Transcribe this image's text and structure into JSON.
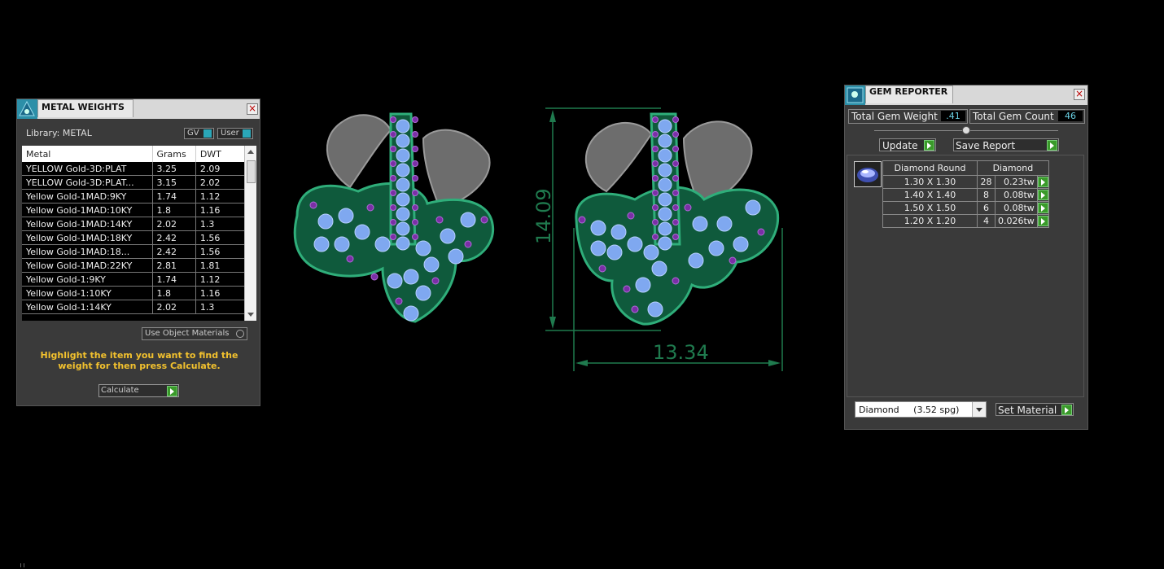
{
  "metal_panel": {
    "title": "METAL WEIGHTS",
    "library_label": "Library: METAL",
    "gv_label": "GV",
    "user_label": "User",
    "columns": [
      "Metal",
      "Grams",
      "DWT"
    ],
    "rows": [
      [
        "YELLOW Gold-3D:PLAT",
        "3.25",
        "2.09"
      ],
      [
        "YELLOW Gold-3D:PLAT...",
        "3.15",
        "2.02"
      ],
      [
        "Yellow Gold-1MAD:9KY",
        "1.74",
        "1.12"
      ],
      [
        "Yellow Gold-1MAD:10KY",
        "1.8",
        "1.16"
      ],
      [
        "Yellow Gold-1MAD:14KY",
        "2.02",
        "1.3"
      ],
      [
        "Yellow Gold-1MAD:18KY",
        "2.42",
        "1.56"
      ],
      [
        "Yellow Gold-1MAD:18...",
        "2.42",
        "1.56"
      ],
      [
        "Yellow Gold-1MAD:22KY",
        "2.81",
        "1.81"
      ],
      [
        "Yellow Gold-1:9KY",
        "1.74",
        "1.12"
      ],
      [
        "Yellow Gold-1:10KY",
        "1.8",
        "1.16"
      ],
      [
        "Yellow Gold-1:14KY",
        "2.02",
        "1.3"
      ]
    ],
    "use_object_materials": "Use Object Materials",
    "instruction": "Highlight the item you want to find the weight for then press Calculate.",
    "calculate_label": "Calculate"
  },
  "viewport": {
    "height_dim": "14.09",
    "width_dim": "13.34"
  },
  "gem_panel": {
    "title": "GEM REPORTER",
    "total_weight_label": "Total Gem Weight",
    "total_weight_value": ".41",
    "total_count_label": "Total Gem Count",
    "total_count_value": "46",
    "update_label": "Update",
    "save_report_label": "Save Report",
    "table_header_shape": "Diamond Round",
    "table_header_material": "Diamond",
    "rows": [
      [
        "1.30 X 1.30",
        "28",
        "0.23tw"
      ],
      [
        "1.40 X 1.40",
        "8",
        "0.08tw"
      ],
      [
        "1.50 X 1.50",
        "6",
        "0.08tw"
      ],
      [
        "1.20 X 1.20",
        "4",
        "0.026tw"
      ]
    ],
    "material_select": "Diamond     (3.52 spg)",
    "set_material_label": "Set Material"
  },
  "colors": {
    "accent_yellow": "#f2c12e",
    "dimension_green": "#1f7a4e",
    "setting_green": "#1f8f5a",
    "stone_blue": "#7fa8f0",
    "stone_purple": "#7a2fa6"
  }
}
